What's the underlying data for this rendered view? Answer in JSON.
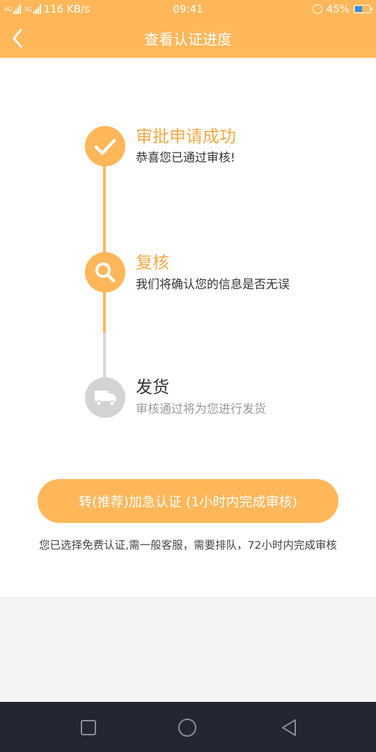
{
  "status_bar": {
    "network_1": "4G",
    "network_2": "3G",
    "speed": "116 KB/s",
    "time": "09:41",
    "battery": "45%"
  },
  "header": {
    "title": "查看认证进度"
  },
  "steps": [
    {
      "title": "审批申请成功",
      "desc": "恭喜您已通过审核!",
      "icon": "check-icon",
      "state": "done"
    },
    {
      "title": "复核",
      "desc": "我们将确认您的信息是否无误",
      "icon": "search-icon",
      "state": "active"
    },
    {
      "title": "发货",
      "desc": "审核通过将为您进行发货",
      "icon": "truck-icon",
      "state": "pending"
    }
  ],
  "urgent_button": {
    "label": "转(推荐)加急认证 (1小时内完成审核)"
  },
  "note": "您已选择免费认证,需一般客服，需要排队，72小时内完成审核",
  "colors": {
    "accent": "#ffb75a",
    "done_title": "#f5a946",
    "pending_icon": "#d3d3d3",
    "pending_desc": "#9a9a9a",
    "system_nav": "#222733"
  }
}
